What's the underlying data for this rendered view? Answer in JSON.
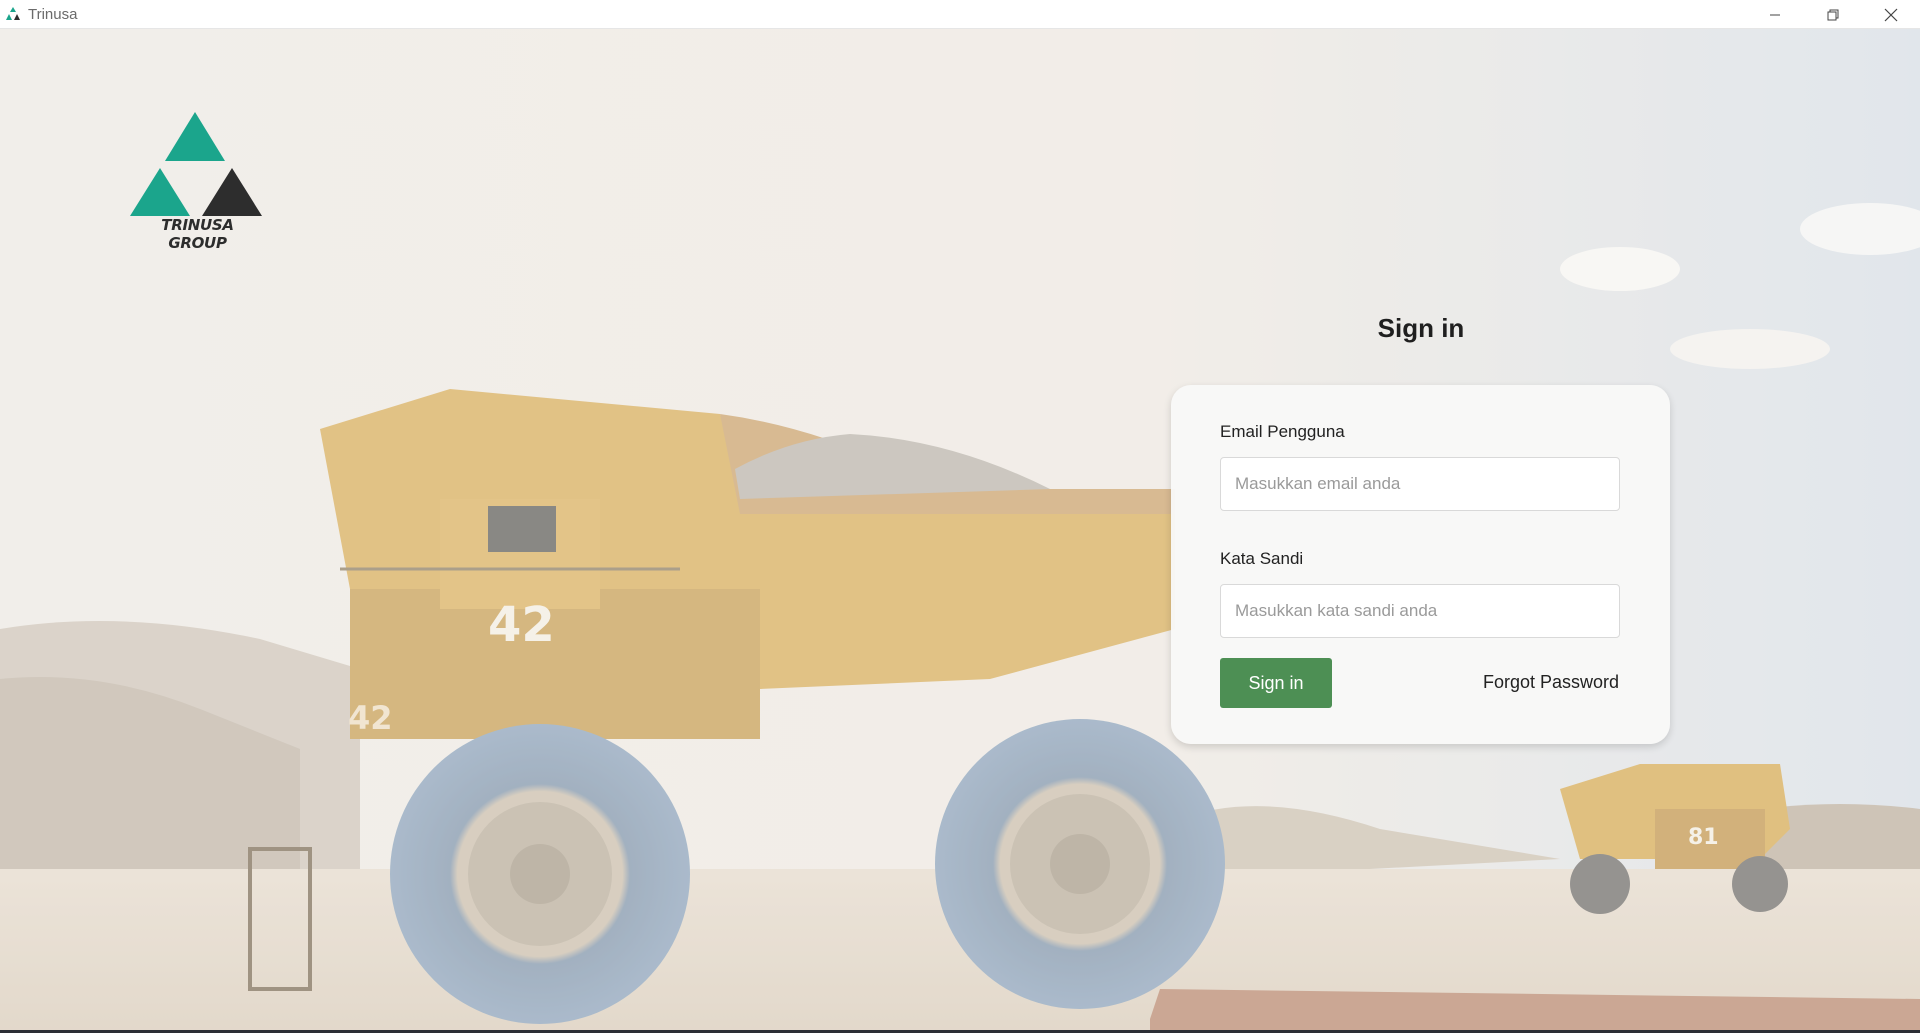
{
  "window": {
    "title": "Trinusa",
    "controls": {
      "minimize": "minimize-icon",
      "restore": "restore-icon",
      "close": "close-icon"
    }
  },
  "brand": {
    "logo_text": "TRINUSA GROUP",
    "colors": {
      "teal": "#1ba58c",
      "dark": "#2d2d2d"
    }
  },
  "login": {
    "title": "Sign in",
    "email": {
      "label": "Email Pengguna",
      "placeholder": "Masukkan email anda",
      "value": ""
    },
    "password": {
      "label": "Kata Sandi",
      "placeholder": "Masukkan kata sandi anda",
      "value": ""
    },
    "submit_label": "Sign in",
    "forgot_label": "Forgot Password",
    "accent": "#4d8f54"
  },
  "background": {
    "truck_front_number": "42",
    "truck_side_number": "42",
    "truck_far_number": "81"
  }
}
